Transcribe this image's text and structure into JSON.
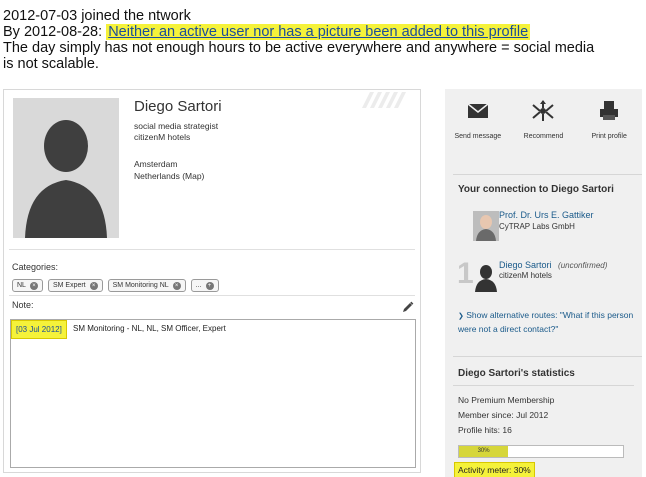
{
  "annotation": {
    "line1": "2012-07-03 joined the ntwork",
    "line2_prefix": "By 2012-08-28: ",
    "line2_highlight": "Neither an active user nor has a picture been added to this profile",
    "line3": "The day simply has not enough hours to be active everywhere and anywhere = social media",
    "line4": "is not scalable."
  },
  "profile": {
    "name": "Diego Sartori",
    "title": "social media strategist",
    "company": "citizenM hotels",
    "city": "Amsterdam",
    "country": "Netherlands (Map)",
    "categories_label": "Categories:",
    "tags": [
      "NL",
      "SM Expert",
      "SM Monitoring NL",
      "..."
    ],
    "note_label": "Note:",
    "note_date": "[03 Jul 2012]",
    "note_text": "SM Monitoring - NL, NL, SM Officer, Expert"
  },
  "sidebar": {
    "actions": [
      {
        "label": "Send message",
        "icon": "envelope-icon"
      },
      {
        "label": "Recommend",
        "icon": "share-icon"
      },
      {
        "label": "Print profile",
        "icon": "printer-icon"
      }
    ],
    "connection_title": "Your connection to Diego Sartori",
    "contact1_name": "Prof. Dr. Urs E. Gattiker",
    "contact1_company": "CyTRAP Labs GmbH",
    "contact2_name": "Diego Sartori",
    "contact2_status": "(unconfirmed)",
    "contact2_company": "citizenM hotels",
    "degree": "1",
    "alt_routes": "Show alternative routes: \"What if this person were not a direct contact?\"",
    "stats_title": "Diego Sartori's statistics",
    "membership": "No Premium Membership",
    "member_since": "Member since: Jul 2012",
    "profile_hits": "Profile hits: 16",
    "activity_value": 0.3,
    "activity_pct": "30%",
    "activity_label": "Activity meter: 30%"
  },
  "colors": {
    "highlight": "#f5f23a",
    "link": "#1a5a8a",
    "meter": "#d6d63a"
  }
}
